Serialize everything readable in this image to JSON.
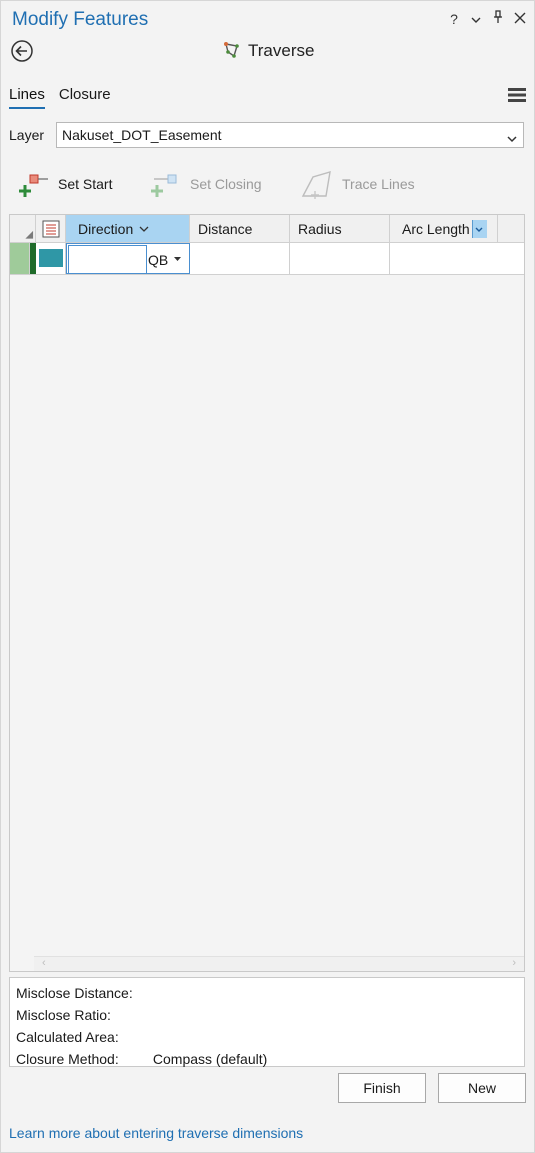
{
  "pane": {
    "title": "Modify Features",
    "controls": {
      "help": "?",
      "dropdown": "⌄",
      "pin": "📌",
      "close": "✕"
    }
  },
  "tool": {
    "title": "Traverse"
  },
  "tabs": [
    {
      "label": "Lines",
      "active": true
    },
    {
      "label": "Closure",
      "active": false
    }
  ],
  "layer": {
    "label": "Layer",
    "value": "Nakuset_DOT_Easement"
  },
  "toolbar": {
    "set_start": "Set Start",
    "set_closing": "Set Closing",
    "trace_lines": "Trace Lines"
  },
  "grid": {
    "columns": [
      "Direction",
      "Distance",
      "Radius",
      "Arc Length"
    ],
    "row": {
      "direction_value": "",
      "direction_unit": "QB",
      "distance": "",
      "radius": "",
      "arc_length": ""
    }
  },
  "closure_stats": {
    "misclose_distance_label": "Misclose Distance:",
    "misclose_distance_value": "",
    "misclose_ratio_label": "Misclose Ratio:",
    "misclose_ratio_value": "",
    "calculated_area_label": "Calculated Area:",
    "calculated_area_value": "",
    "closure_method_label": "Closure Method:",
    "closure_method_value": "Compass (default)"
  },
  "buttons": {
    "finish": "Finish",
    "new": "New"
  },
  "help_link": "Learn more about entering traverse dimensions",
  "colors": {
    "accent": "#1f6fb2",
    "selected_header": "#a9d4f2",
    "row_swatch": "#2f97a6",
    "row_marker": "#2e7d32"
  }
}
